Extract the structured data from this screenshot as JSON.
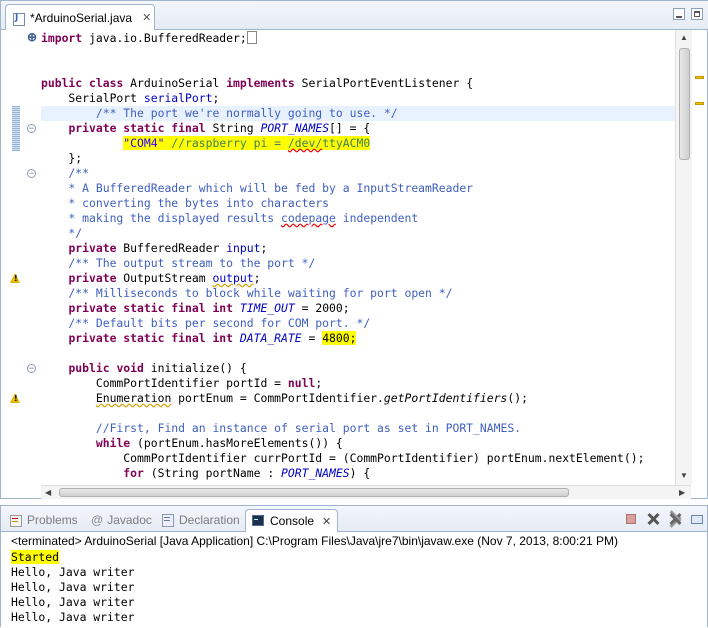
{
  "editor": {
    "tab": {
      "title": "*ArduinoSerial.java",
      "close": "✕"
    },
    "code": {
      "l1_import": "import",
      "l1_pkg": " java.io.BufferedReader;",
      "l4_public": "public",
      "l4_class": "class",
      "l4_name": " ArduinoSerial ",
      "l4_implements": "implements",
      "l4_iface": " SerialPortEventListener {",
      "l5_type": "    SerialPort ",
      "l5_field": "serialPort",
      "l5_end": ";",
      "l6_comment": "        /** The port we're normally going to use. */",
      "l7_mods": "private static final",
      "l7_type": " String ",
      "l7_field": "PORT_NAMES",
      "l7_end": "[] = {",
      "l8_string": "\"COM4\"",
      "l8_comment": " //raspberry pi = ",
      "l8_dev": "/dev/",
      "l8_tty": "ttyACM0",
      "l9_close": "    };",
      "l10": "    /**",
      "l11": "    * A BufferedReader which will be fed by a InputStreamReader",
      "l12": "    * converting the bytes into characters",
      "l13a": "    * making the displayed results ",
      "l13b": "codepage",
      "l13c": " independent",
      "l14": "    */",
      "l15_mods": "private",
      "l15_type": " BufferedReader ",
      "l15_field": "input",
      "l15_end": ";",
      "l16": "    /** The output stream to the port */",
      "l17_mods": "private",
      "l17_type": " OutputStream ",
      "l17_field": "output",
      "l17_end": ";",
      "l18": "    /** Milliseconds to block while waiting for port open */",
      "l19_mods": "private static final int",
      "l19_field": " TIME_OUT",
      "l19_end": " = 2000;",
      "l20": "    /** Default bits per second for COM port. */",
      "l21_mods": "private static final int",
      "l21_field": " DATA_RATE",
      "l21_eq": " = ",
      "l21_val": "4800;",
      "l23_public": "public",
      "l23_void": "void",
      "l23_rest": " initialize() {",
      "l24_type": "        CommPortIdentifier portId = ",
      "l24_null": "null",
      "l24_end": ";",
      "l25_type": "Enumeration",
      "l25_rest": " portEnum = CommPortIdentifier.",
      "l25_method": "getPortIdentifiers",
      "l25_end": "();",
      "l27": "        //First, Find an instance of serial port as set in PORT_NAMES.",
      "l28_while": "while",
      "l28_rest": " (portEnum.hasMoreElements()) {",
      "l29": "            CommPortIdentifier currPortId = (CommPortIdentifier) portEnum.nextElement();",
      "l30_for": "for",
      "l30_a": " (String portName : ",
      "l30_b": "PORT_NAMES",
      "l30_c": ") {"
    }
  },
  "console": {
    "tabs": {
      "problems": "Problems",
      "javadoc": "Javadoc",
      "declaration": "Declaration",
      "console": "Console",
      "close": "✕"
    },
    "header": "<terminated> ArduinoSerial [Java Application] C:\\Program Files\\Java\\jre7\\bin\\javaw.exe (Nov 7, 2013, 8:00:21 PM)",
    "lines": [
      "Started",
      "Hello, Java writer",
      "Hello, Java writer",
      "Hello, Java writer",
      "Hello, Java writer"
    ]
  },
  "icons": {
    "javadoc": "@",
    "fold_plus": "⊕",
    "fold_minus": "−",
    "arrow_up": "▲",
    "arrow_down": "▼",
    "arrow_left": "◀",
    "arrow_right": "▶"
  }
}
